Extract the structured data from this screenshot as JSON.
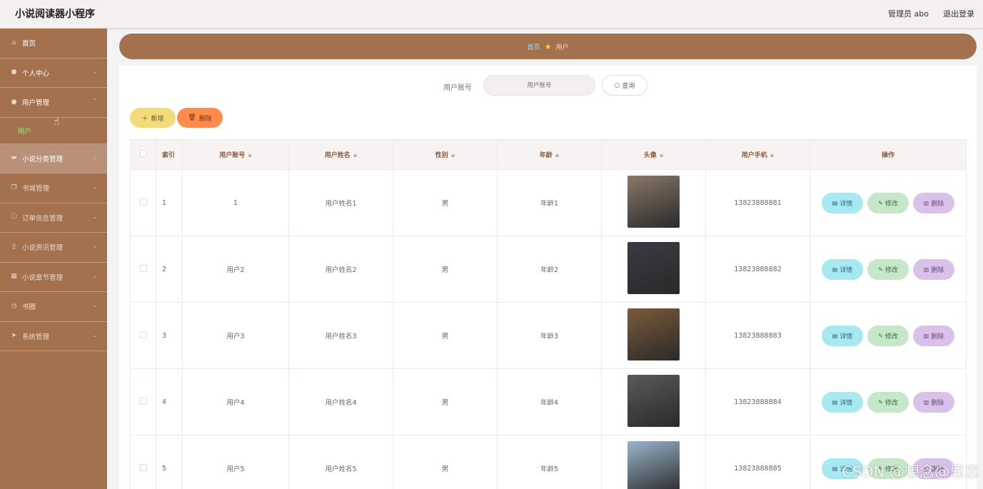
{
  "app": {
    "title": "小说阅读器小程序",
    "user": "管理员 abo",
    "logout": "退出登录"
  },
  "sidebar": {
    "items": [
      {
        "label": "首页",
        "icon": "home-icon",
        "has_chevron": false
      },
      {
        "label": "个人中心",
        "icon": "user-icon",
        "has_chevron": true
      },
      {
        "label": "用户管理",
        "icon": "bulb-icon",
        "has_chevron": true
      },
      {
        "label": "小说分类管理",
        "icon": "briefcase-icon",
        "has_chevron": true
      },
      {
        "label": "书城管理",
        "icon": "copy-icon",
        "has_chevron": true
      },
      {
        "label": "订单信息管理",
        "icon": "info-icon",
        "has_chevron": true
      },
      {
        "label": "小说资讯管理",
        "icon": "mobile-icon",
        "has_chevron": true
      },
      {
        "label": "小说章节管理",
        "icon": "calendar-icon",
        "has_chevron": true
      },
      {
        "label": "书圈",
        "icon": "clock-icon",
        "has_chevron": true
      },
      {
        "label": "系统管理",
        "icon": "send-icon",
        "has_chevron": true
      }
    ],
    "submenu": {
      "label": "用户"
    }
  },
  "breadcrumb": {
    "home": "首页",
    "current": "用户"
  },
  "search": {
    "label": "用户账号",
    "placeholder": "用户账号",
    "button": "查询"
  },
  "actions": {
    "add": "新增",
    "delete": "删除"
  },
  "table": {
    "headers": {
      "index": "索引",
      "account": "用户账号",
      "name": "用户姓名",
      "gender": "性别",
      "age": "年龄",
      "avatar": "头像",
      "phone": "用户手机",
      "ops": "操作"
    },
    "op_labels": {
      "detail": "详情",
      "edit": "修改",
      "delete": "删除"
    },
    "rows": [
      {
        "index": "1",
        "account": "1",
        "name": "用户姓名1",
        "gender": "男",
        "age": "年龄1",
        "phone": "13823888881",
        "avatar_color": "#8a7868"
      },
      {
        "index": "2",
        "account": "用户2",
        "name": "用户姓名2",
        "gender": "男",
        "age": "年龄2",
        "phone": "13823888882",
        "avatar_color": "#3a3a44"
      },
      {
        "index": "3",
        "account": "用户3",
        "name": "用户姓名3",
        "gender": "男",
        "age": "年龄3",
        "phone": "13823888883",
        "avatar_color": "#7a5a3a"
      },
      {
        "index": "4",
        "account": "用户4",
        "name": "用户姓名4",
        "gender": "男",
        "age": "年龄4",
        "phone": "13823888884",
        "avatar_color": "#5a5a5e"
      },
      {
        "index": "5",
        "account": "用户5",
        "name": "用户姓名5",
        "gender": "男",
        "age": "年龄5",
        "phone": "13823888885",
        "avatar_color": "#9ab4cc"
      }
    ]
  },
  "watermark": "CSDN @想念@思恋",
  "colors": {
    "sidebar": "#a3714e",
    "accent_green": "#8ef06a",
    "add_btn": "#f2dc7a",
    "del_btn": "#ff8c4d"
  }
}
